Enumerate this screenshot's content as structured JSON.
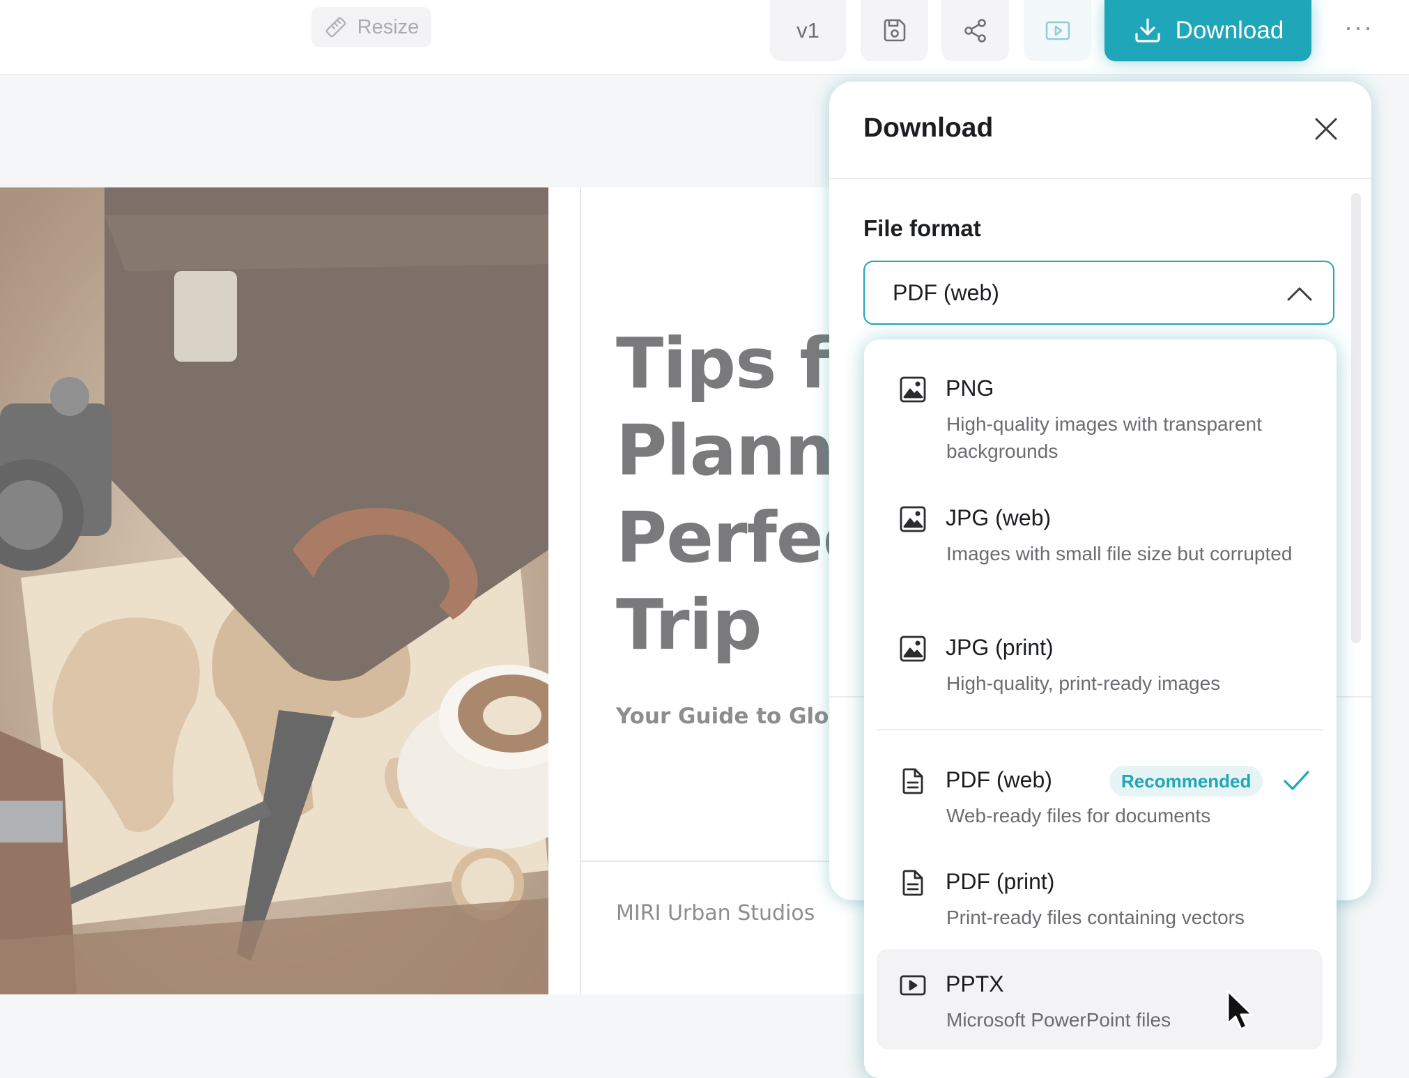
{
  "toolbar": {
    "resize_label": "Resize",
    "version_label": "v1",
    "download_label": "Download",
    "more_label": "···"
  },
  "canvas": {
    "title_lines": [
      "Tips fo",
      "Plann",
      "Perfec",
      "Trip"
    ],
    "subtitle": "Your Guide to Glob",
    "studio": "MIRI Urban Studios"
  },
  "panel": {
    "title": "Download",
    "file_format_label": "File format",
    "selected_format": "PDF (web)"
  },
  "formats": [
    {
      "name": "PNG",
      "desc": "High-quality images with transparent backgrounds",
      "icon": "image-icon"
    },
    {
      "name": "JPG (web)",
      "desc": "Images with small file size but corrupted",
      "icon": "image-icon"
    },
    {
      "name": "JPG (print)",
      "desc": "High-quality, print-ready images",
      "icon": "image-icon"
    },
    {
      "name": "PDF (web)",
      "desc": "Web-ready files for documents",
      "icon": "document-icon",
      "badge": "Recommended",
      "selected": true
    },
    {
      "name": "PDF (print)",
      "desc": "Print-ready files containing vectors",
      "icon": "document-icon"
    },
    {
      "name": "PPTX",
      "desc": "Microsoft PowerPoint files",
      "icon": "presentation-icon",
      "hovered": true
    }
  ],
  "colors": {
    "accent": "#1fa6b8",
    "badge_bg": "#e6f4f6",
    "text": "#1b1d21",
    "muted": "#6b6c71"
  }
}
